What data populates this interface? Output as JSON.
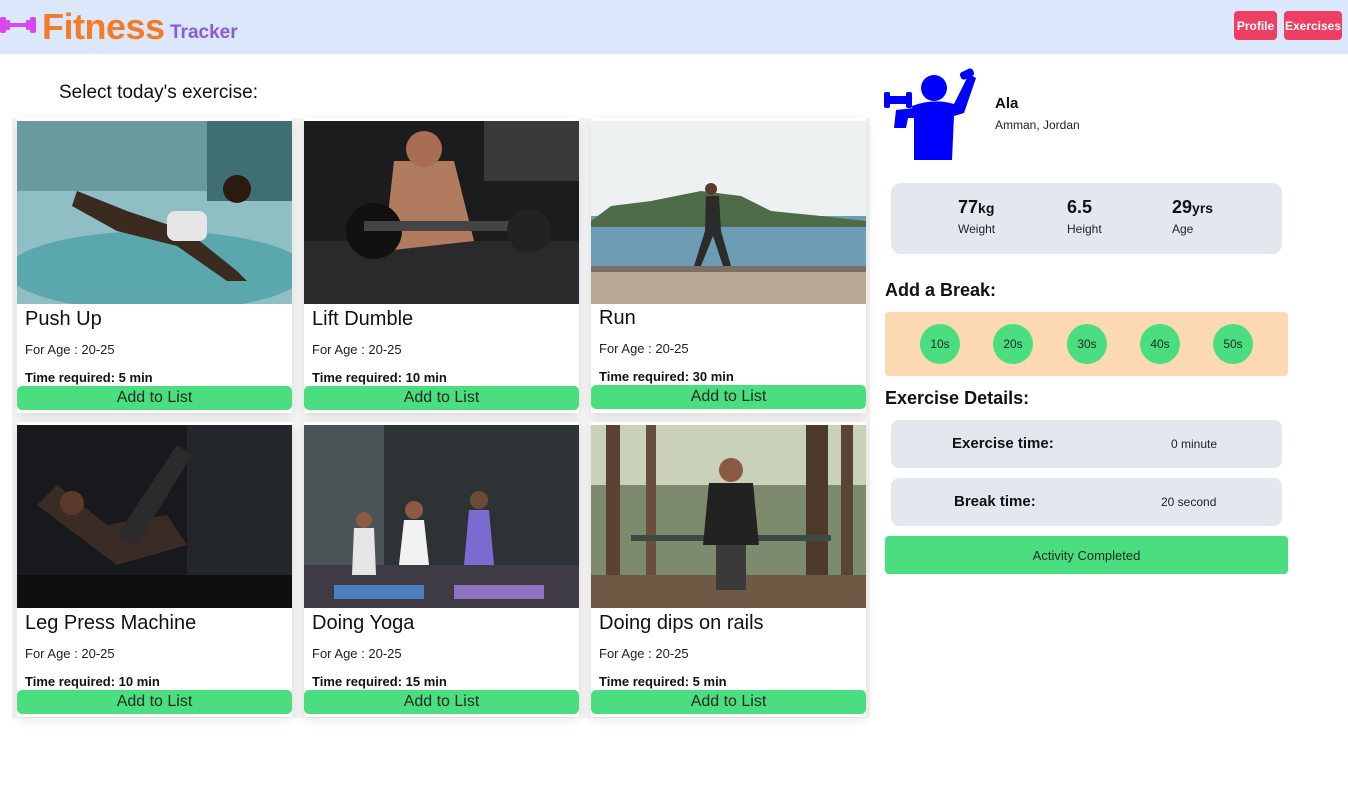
{
  "header": {
    "brand": "Fitness",
    "brand_sub": "Tracker",
    "nav": {
      "profile": "Profile",
      "exercises": "Exercises"
    }
  },
  "main": {
    "title": "Select today's exercise:",
    "cards": [
      {
        "name": "Push Up",
        "age": "For Age : 20-25",
        "time": "Time required: 5 min",
        "button": "Add to List",
        "image": "push-up-photo"
      },
      {
        "name": "Lift Dumble",
        "age": "For Age : 20-25",
        "time": "Time required: 10 min",
        "button": "Add to List",
        "image": "dumbbell-curl-photo"
      },
      {
        "name": "Run",
        "age": "For Age : 20-25",
        "time": "Time required: 30 min",
        "button": "Add to List",
        "image": "seaside-run-photo"
      },
      {
        "name": "Leg Press Machine",
        "age": "For Age : 20-25",
        "time": "Time required: 10 min",
        "button": "Add to List",
        "image": "leg-press-photo"
      },
      {
        "name": "Doing Yoga",
        "age": "For Age : 20-25",
        "time": "Time required: 15 min",
        "button": "Add to List",
        "image": "yoga-class-photo"
      },
      {
        "name": "Doing dips on rails",
        "age": "For Age : 20-25",
        "time": "Time required: 5 min",
        "button": "Add to List",
        "image": "dips-rails-photo"
      }
    ]
  },
  "profile": {
    "name": "Ala",
    "location": "Amman, Jordan",
    "stats": [
      {
        "value": "77",
        "unit": "kg",
        "label": "Weight"
      },
      {
        "value": "6.5",
        "unit": "",
        "label": "Height"
      },
      {
        "value": "29",
        "unit": "yrs",
        "label": "Age"
      }
    ]
  },
  "break": {
    "title": "Add a Break:",
    "options": [
      "10s",
      "20s",
      "30s",
      "40s",
      "50s"
    ]
  },
  "details": {
    "title": "Exercise Details:",
    "exercise_label": "Exercise time:",
    "exercise_value": "0 minute",
    "break_label": "Break time:",
    "break_value": "20 second",
    "complete_button": "Activity Completed"
  },
  "colors": {
    "header_bg": "#dbe8fb",
    "brand": "#f47c28",
    "brand_sub": "#8a5ad8",
    "nav_button": "#ef3e63",
    "green": "#4ade80",
    "break_bg": "#fcd9b0",
    "panel_bg": "#e3e8ef",
    "avatar": "#0000ff"
  }
}
